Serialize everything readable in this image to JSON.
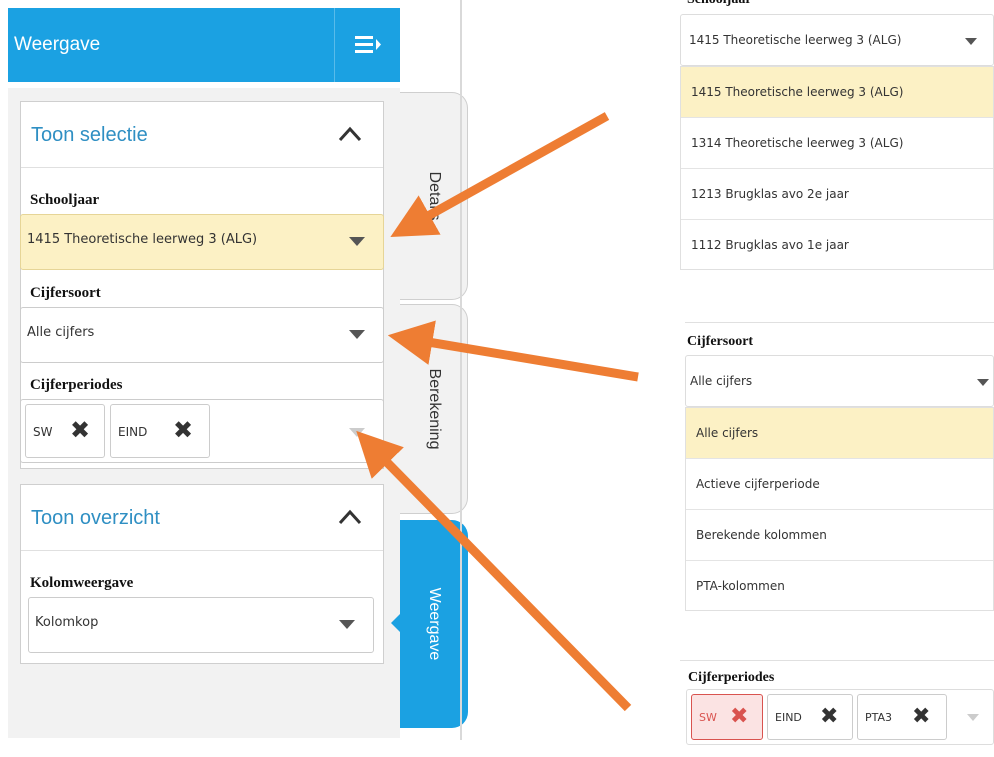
{
  "left": {
    "header_title": "Weergave",
    "selection": {
      "title": "Toon selectie",
      "schooljaar_label": "Schooljaar",
      "schooljaar_value": "1415 Theoretische leerweg 3 (ALG)",
      "cijfersoort_label": "Cijfersoort",
      "cijfersoort_value": "Alle cijfers",
      "cijferperiodes_label": "Cijferperiodes",
      "tags": [
        "SW",
        "EIND"
      ]
    },
    "overview": {
      "title": "Toon overzicht",
      "kolomweergave_label": "Kolomweergave",
      "kolomweergave_value": "Kolomkop"
    },
    "tabs": [
      "Details",
      "Berekening",
      "Weergave"
    ]
  },
  "right": {
    "schooljaar": {
      "label": "Schooljaar",
      "value": "1415 Theoretische leerweg 3 (ALG)",
      "options": [
        "1415 Theoretische leerweg 3 (ALG)",
        "1314 Theoretische leerweg 3 (ALG)",
        "1213 Brugklas avo 2e jaar",
        "1112 Brugklas avo 1e jaar"
      ]
    },
    "cijfersoort": {
      "label": "Cijfersoort",
      "value": "Alle cijfers",
      "options": [
        "Alle cijfers",
        "Actieve cijferperiode",
        "Berekende kolommen",
        "PTA-kolommen"
      ]
    },
    "cijferperiodes": {
      "label": "Cijferperiodes",
      "tags": [
        "SW",
        "EIND",
        "PTA3"
      ]
    }
  },
  "colors": {
    "accent": "#1ba1e2",
    "highlight": "#fcf1c5",
    "arrow": "#ee7d33",
    "error": "#d9534f"
  },
  "icons": {
    "header_menu": "menu-collapse-icon",
    "collapse": "chevron-up-icon",
    "dropdown": "caret-down-icon",
    "remove": "close-icon"
  }
}
